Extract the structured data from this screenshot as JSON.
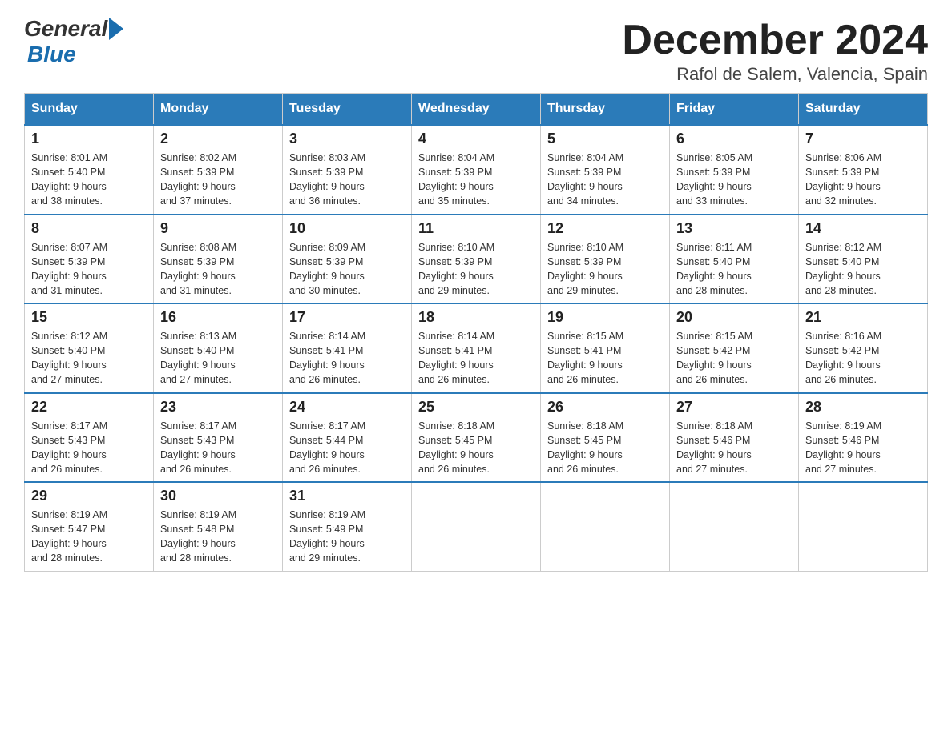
{
  "logo": {
    "general": "General",
    "blue": "Blue"
  },
  "title": "December 2024",
  "subtitle": "Rafol de Salem, Valencia, Spain",
  "days_header": [
    "Sunday",
    "Monday",
    "Tuesday",
    "Wednesday",
    "Thursday",
    "Friday",
    "Saturday"
  ],
  "weeks": [
    [
      {
        "day": "1",
        "sunrise": "8:01 AM",
        "sunset": "5:40 PM",
        "daylight": "9 hours and 38 minutes."
      },
      {
        "day": "2",
        "sunrise": "8:02 AM",
        "sunset": "5:39 PM",
        "daylight": "9 hours and 37 minutes."
      },
      {
        "day": "3",
        "sunrise": "8:03 AM",
        "sunset": "5:39 PM",
        "daylight": "9 hours and 36 minutes."
      },
      {
        "day": "4",
        "sunrise": "8:04 AM",
        "sunset": "5:39 PM",
        "daylight": "9 hours and 35 minutes."
      },
      {
        "day": "5",
        "sunrise": "8:04 AM",
        "sunset": "5:39 PM",
        "daylight": "9 hours and 34 minutes."
      },
      {
        "day": "6",
        "sunrise": "8:05 AM",
        "sunset": "5:39 PM",
        "daylight": "9 hours and 33 minutes."
      },
      {
        "day": "7",
        "sunrise": "8:06 AM",
        "sunset": "5:39 PM",
        "daylight": "9 hours and 32 minutes."
      }
    ],
    [
      {
        "day": "8",
        "sunrise": "8:07 AM",
        "sunset": "5:39 PM",
        "daylight": "9 hours and 31 minutes."
      },
      {
        "day": "9",
        "sunrise": "8:08 AM",
        "sunset": "5:39 PM",
        "daylight": "9 hours and 31 minutes."
      },
      {
        "day": "10",
        "sunrise": "8:09 AM",
        "sunset": "5:39 PM",
        "daylight": "9 hours and 30 minutes."
      },
      {
        "day": "11",
        "sunrise": "8:10 AM",
        "sunset": "5:39 PM",
        "daylight": "9 hours and 29 minutes."
      },
      {
        "day": "12",
        "sunrise": "8:10 AM",
        "sunset": "5:39 PM",
        "daylight": "9 hours and 29 minutes."
      },
      {
        "day": "13",
        "sunrise": "8:11 AM",
        "sunset": "5:40 PM",
        "daylight": "9 hours and 28 minutes."
      },
      {
        "day": "14",
        "sunrise": "8:12 AM",
        "sunset": "5:40 PM",
        "daylight": "9 hours and 28 minutes."
      }
    ],
    [
      {
        "day": "15",
        "sunrise": "8:12 AM",
        "sunset": "5:40 PM",
        "daylight": "9 hours and 27 minutes."
      },
      {
        "day": "16",
        "sunrise": "8:13 AM",
        "sunset": "5:40 PM",
        "daylight": "9 hours and 27 minutes."
      },
      {
        "day": "17",
        "sunrise": "8:14 AM",
        "sunset": "5:41 PM",
        "daylight": "9 hours and 26 minutes."
      },
      {
        "day": "18",
        "sunrise": "8:14 AM",
        "sunset": "5:41 PM",
        "daylight": "9 hours and 26 minutes."
      },
      {
        "day": "19",
        "sunrise": "8:15 AM",
        "sunset": "5:41 PM",
        "daylight": "9 hours and 26 minutes."
      },
      {
        "day": "20",
        "sunrise": "8:15 AM",
        "sunset": "5:42 PM",
        "daylight": "9 hours and 26 minutes."
      },
      {
        "day": "21",
        "sunrise": "8:16 AM",
        "sunset": "5:42 PM",
        "daylight": "9 hours and 26 minutes."
      }
    ],
    [
      {
        "day": "22",
        "sunrise": "8:17 AM",
        "sunset": "5:43 PM",
        "daylight": "9 hours and 26 minutes."
      },
      {
        "day": "23",
        "sunrise": "8:17 AM",
        "sunset": "5:43 PM",
        "daylight": "9 hours and 26 minutes."
      },
      {
        "day": "24",
        "sunrise": "8:17 AM",
        "sunset": "5:44 PM",
        "daylight": "9 hours and 26 minutes."
      },
      {
        "day": "25",
        "sunrise": "8:18 AM",
        "sunset": "5:45 PM",
        "daylight": "9 hours and 26 minutes."
      },
      {
        "day": "26",
        "sunrise": "8:18 AM",
        "sunset": "5:45 PM",
        "daylight": "9 hours and 26 minutes."
      },
      {
        "day": "27",
        "sunrise": "8:18 AM",
        "sunset": "5:46 PM",
        "daylight": "9 hours and 27 minutes."
      },
      {
        "day": "28",
        "sunrise": "8:19 AM",
        "sunset": "5:46 PM",
        "daylight": "9 hours and 27 minutes."
      }
    ],
    [
      {
        "day": "29",
        "sunrise": "8:19 AM",
        "sunset": "5:47 PM",
        "daylight": "9 hours and 28 minutes."
      },
      {
        "day": "30",
        "sunrise": "8:19 AM",
        "sunset": "5:48 PM",
        "daylight": "9 hours and 28 minutes."
      },
      {
        "day": "31",
        "sunrise": "8:19 AM",
        "sunset": "5:49 PM",
        "daylight": "9 hours and 29 minutes."
      },
      null,
      null,
      null,
      null
    ]
  ],
  "labels": {
    "sunrise": "Sunrise:",
    "sunset": "Sunset:",
    "daylight": "Daylight:"
  }
}
